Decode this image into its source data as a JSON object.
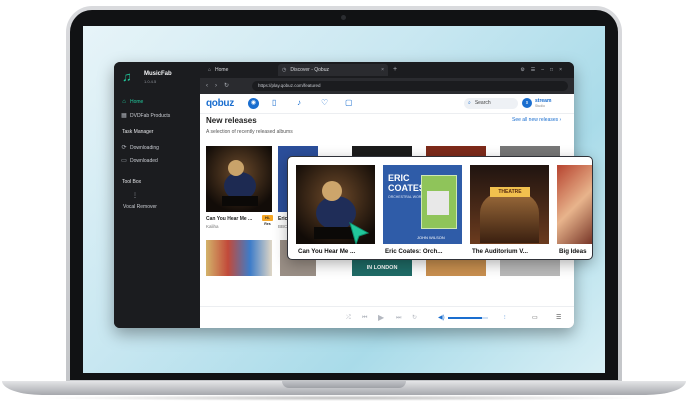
{
  "sidebar": {
    "app_name": "MusicFab",
    "version": "1.0.4.5",
    "items": [
      {
        "label": "Home",
        "icon": "home-icon",
        "active": true
      },
      {
        "label": "DVDFab Products",
        "icon": "grid-icon",
        "active": false
      }
    ],
    "task_manager": {
      "heading": "Task Manager",
      "items": [
        {
          "label": "Downloading",
          "icon": "download-icon"
        },
        {
          "label": "Downloaded",
          "icon": "folder-icon"
        }
      ]
    },
    "toolbox": {
      "heading": "Tool Box",
      "items": [
        {
          "label": "Vocal Remover",
          "icon": "vocal-remover-icon"
        }
      ]
    }
  },
  "tabs": [
    {
      "title": "Home",
      "icon": "home-icon"
    },
    {
      "title": "Discover - Qobuz",
      "icon": "clock-icon",
      "active": true
    }
  ],
  "address_bar": {
    "url": "https://play.qobuz.com/featured"
  },
  "qobuz": {
    "logo": "qobuz",
    "search_placeholder": "Search",
    "user": {
      "name": "stream",
      "plan": "Studio"
    }
  },
  "section": {
    "title": "New releases",
    "subtitle": "A selection of recently released albums",
    "see_all": "See all new releases"
  },
  "albums": [
    {
      "title": "Can You Hear Me ...",
      "artist": "Kaliha",
      "hires": "Hi-Res"
    },
    {
      "title": "Eric C...",
      "artist": "BBC"
    }
  ],
  "popup": {
    "cards": [
      {
        "title": "Can You Hear Me ..."
      },
      {
        "title": "Eric Coates: Orch..."
      },
      {
        "title": "The Auditorium V..."
      },
      {
        "title": "Big Ideas"
      }
    ],
    "cover_texts": {
      "eric_coates_1": "ERIC",
      "eric_coates_2": "COATES",
      "eric_coates_3": "ORCHESTRAL WORKS",
      "eric_coates_4": "JOHN WILSON",
      "theatre": "THEATRE"
    }
  },
  "row2": {
    "in_london": "IN LONDON"
  },
  "player": {
    "volume": 0.85
  },
  "colors": {
    "accent": "#21c79b",
    "qobuz_blue": "#1a6ecf",
    "hires": "#f5a623"
  }
}
